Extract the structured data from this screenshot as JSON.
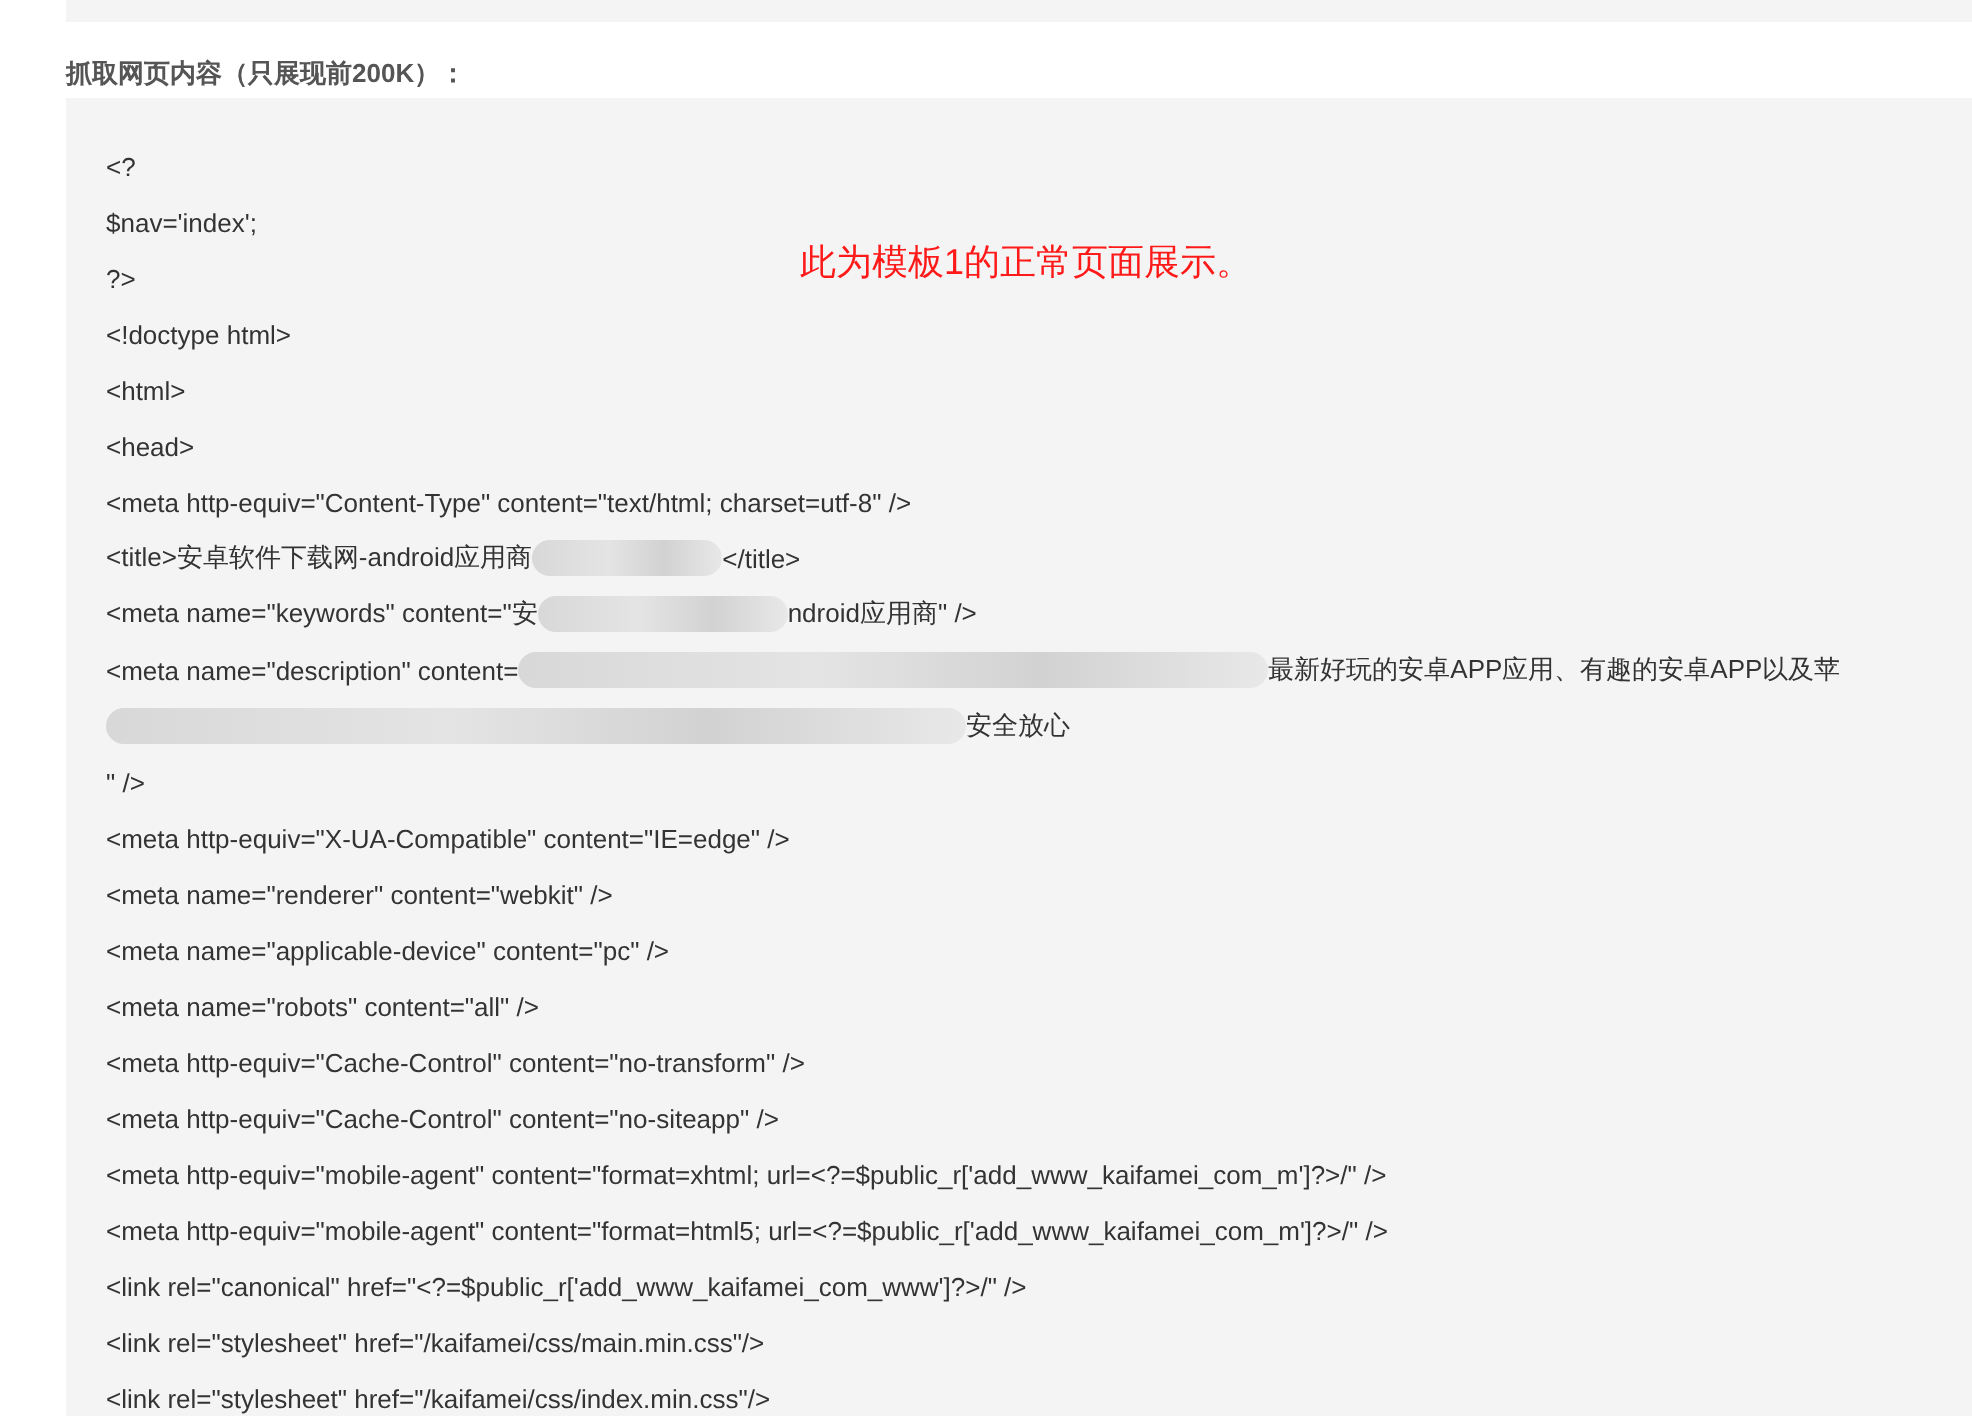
{
  "heading": "抓取网页内容（只展现前200K）：",
  "annotation": "此为模板1的正常页面展示。",
  "code_lines": [
    [
      {
        "kind": "text",
        "text": "<?"
      }
    ],
    [
      {
        "kind": "text",
        "text": "$nav='index';"
      }
    ],
    [
      {
        "kind": "text",
        "text": "?>"
      }
    ],
    [
      {
        "kind": "text",
        "text": "<!doctype html>"
      }
    ],
    [
      {
        "kind": "text",
        "text": "<html>"
      }
    ],
    [
      {
        "kind": "text",
        "text": "<head>"
      }
    ],
    [
      {
        "kind": "text",
        "text": "<meta http-equiv=\"Content-Type\" content=\"text/html; charset=utf-8\" />"
      }
    ],
    [
      {
        "kind": "text",
        "text": "<title>安卓软件下载网-android应用商"
      },
      {
        "kind": "redaction"
      },
      {
        "kind": "text",
        "text": "</title>"
      }
    ],
    [
      {
        "kind": "text",
        "text": "<meta name=\"keywords\" content=\"安"
      },
      {
        "kind": "redaction"
      },
      {
        "kind": "text",
        "text": "ndroid应用商\" />"
      }
    ],
    [
      {
        "kind": "text",
        "text": "<meta name=\"description\" content="
      },
      {
        "kind": "redaction"
      },
      {
        "kind": "text",
        "text": "最新好玩的安卓APP应用、有趣的安卓APP以及苹"
      }
    ],
    [
      {
        "kind": "redaction"
      },
      {
        "kind": "text",
        "text": "安全放心"
      }
    ],
    [
      {
        "kind": "text",
        "text": "\" />"
      }
    ],
    [
      {
        "kind": "text",
        "text": "<meta http-equiv=\"X-UA-Compatible\" content=\"IE=edge\" />"
      }
    ],
    [
      {
        "kind": "text",
        "text": "<meta name=\"renderer\" content=\"webkit\" />"
      }
    ],
    [
      {
        "kind": "text",
        "text": "<meta name=\"applicable-device\" content=\"pc\" />"
      }
    ],
    [
      {
        "kind": "text",
        "text": "<meta name=\"robots\" content=\"all\" />"
      }
    ],
    [
      {
        "kind": "text",
        "text": "<meta http-equiv=\"Cache-Control\" content=\"no-transform\" />"
      }
    ],
    [
      {
        "kind": "text",
        "text": "<meta http-equiv=\"Cache-Control\" content=\"no-siteapp\" />"
      }
    ],
    [
      {
        "kind": "text",
        "text": "<meta http-equiv=\"mobile-agent\" content=\"format=xhtml; url=<?=$public_r['add_www_kaifamei_com_m']?>/\" />"
      }
    ],
    [
      {
        "kind": "text",
        "text": "<meta http-equiv=\"mobile-agent\" content=\"format=html5; url=<?=$public_r['add_www_kaifamei_com_m']?>/\" />"
      }
    ],
    [
      {
        "kind": "text",
        "text": "<link rel=\"canonical\" href=\"<?=$public_r['add_www_kaifamei_com_www']?>/\" />"
      }
    ],
    [
      {
        "kind": "text",
        "text": "<link rel=\"stylesheet\" href=\"/kaifamei/css/main.min.css\"/>"
      }
    ],
    [
      {
        "kind": "text",
        "text": "<link rel=\"stylesheet\" href=\"/kaifamei/css/index.min.css\"/>"
      }
    ]
  ]
}
